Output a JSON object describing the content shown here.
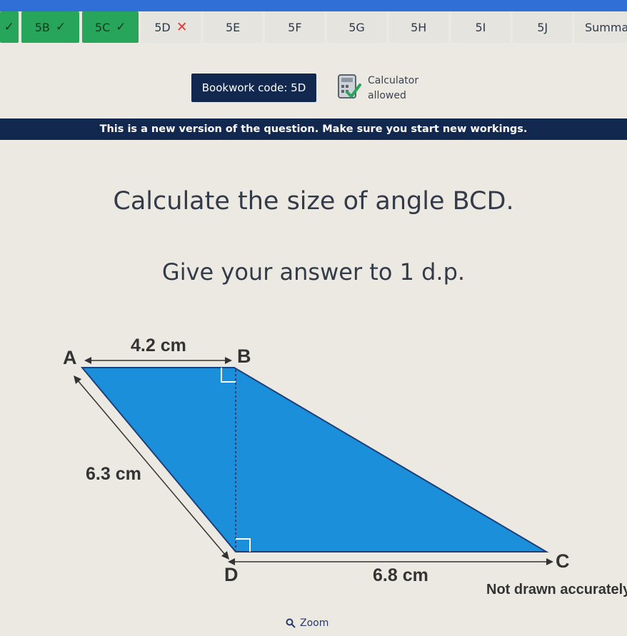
{
  "tabs": [
    {
      "label": "",
      "status": "done"
    },
    {
      "label": "5B",
      "status": "done"
    },
    {
      "label": "5C",
      "status": "done"
    },
    {
      "label": "5D",
      "status": "wrong"
    },
    {
      "label": "5E",
      "status": "none"
    },
    {
      "label": "5F",
      "status": "none"
    },
    {
      "label": "5G",
      "status": "none"
    },
    {
      "label": "5H",
      "status": "none"
    },
    {
      "label": "5I",
      "status": "none"
    },
    {
      "label": "5J",
      "status": "none"
    },
    {
      "label": "Summa",
      "status": "none"
    }
  ],
  "info": {
    "bookwork_label": "Bookwork code: 5D",
    "calculator_line1": "Calculator",
    "calculator_line2": "allowed"
  },
  "banner": "This is a new version of the question. Make sure you start new workings.",
  "question": {
    "title": "Calculate the size of angle BCD.",
    "subtitle": "Give your answer to 1 d.p."
  },
  "diagram": {
    "vertex_a": "A",
    "vertex_b": "B",
    "vertex_c": "C",
    "vertex_d": "D",
    "length_ab": "4.2 cm",
    "length_ad": "6.3 cm",
    "length_dc": "6.8 cm",
    "note": "Not drawn accurately",
    "fill_color": "#1b8fd9"
  },
  "zoom_label": "Zoom",
  "colors": {
    "navy": "#13284f",
    "green": "#27a55a",
    "accent_blue": "#2f6fd6"
  }
}
